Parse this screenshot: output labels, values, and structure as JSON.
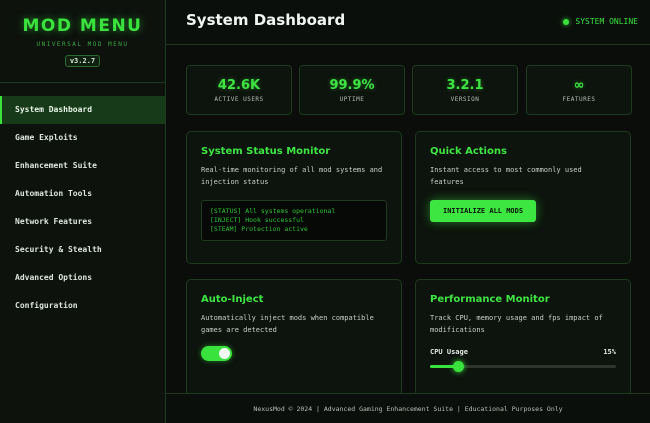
{
  "brand": {
    "title": "MOD MENU",
    "subtitle": "UNIVERSAL MOD MENU",
    "version": "v3.2.7"
  },
  "sidebar": {
    "items": [
      {
        "label": "System Dashboard",
        "active": true
      },
      {
        "label": "Game Exploits"
      },
      {
        "label": "Enhancement Suite"
      },
      {
        "label": "Automation Tools"
      },
      {
        "label": "Network Features"
      },
      {
        "label": "Security & Stealth"
      },
      {
        "label": "Advanced Options"
      },
      {
        "label": "Configuration"
      }
    ]
  },
  "header": {
    "title": "System Dashboard",
    "status": "SYSTEM ONLINE"
  },
  "stats": [
    {
      "value": "42.6K",
      "label": "ACTIVE USERS"
    },
    {
      "value": "99.9%",
      "label": "UPTIME"
    },
    {
      "value": "3.2.1",
      "label": "VERSION"
    },
    {
      "value": "∞",
      "label": "FEATURES"
    }
  ],
  "status_monitor": {
    "title": "System Status Monitor",
    "description": "Real-time monitoring of all mod systems and injection status",
    "logs": [
      "[STATUS] All systems operational",
      "[INJECT] Hook successful",
      "[STEAM] Protection active"
    ]
  },
  "quick_actions": {
    "title": "Quick Actions",
    "description": "Instant access to most commonly used features",
    "button": "INITIALIZE ALL MODS"
  },
  "auto_inject": {
    "title": "Auto-Inject",
    "description": "Automatically inject mods when compatible games are detected",
    "enabled": true
  },
  "performance": {
    "title": "Performance Monitor",
    "description": "Track CPU, memory usage and fps impact of modifications",
    "cpu_label": "CPU Usage",
    "cpu_value": "15%",
    "cpu_fraction": 0.15
  },
  "footer": {
    "text": "NexusMod © 2024 | Advanced Gaming Enhancement Suite | Educational Purposes Only"
  },
  "colors": {
    "accent": "#39e23d",
    "background": "#0a0d0a",
    "border": "#1f3a1f"
  }
}
